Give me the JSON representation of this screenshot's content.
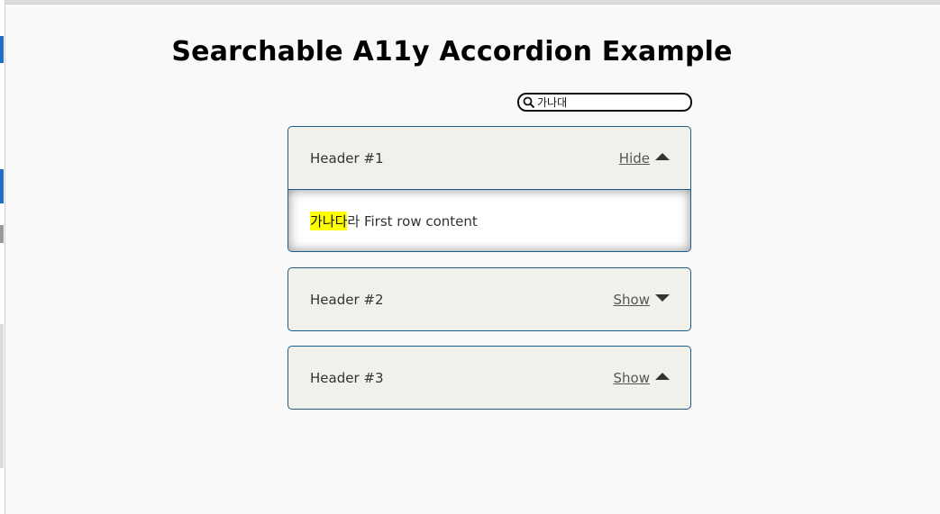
{
  "page": {
    "title": "Searchable A11y Accordion Example"
  },
  "search": {
    "value": "가나대",
    "icon": "search-icon"
  },
  "accordion": {
    "panels": [
      {
        "header": "Header #1",
        "toggle_label": "Hide",
        "toggle_icon": "caret-up-icon",
        "expanded": true,
        "content_highlight": "가나다",
        "content_rest": "라 First row content"
      },
      {
        "header": "Header #2",
        "toggle_label": "Show",
        "toggle_icon": "caret-down-icon",
        "expanded": false
      },
      {
        "header": "Header #3",
        "toggle_label": "Show",
        "toggle_icon": "caret-up-icon",
        "expanded": false
      }
    ]
  },
  "colors": {
    "panel_border": "#1e5c8c",
    "panel_bg": "#f1f0ea",
    "highlight": "#ffff00",
    "page_bg": "#f9f9f9"
  }
}
